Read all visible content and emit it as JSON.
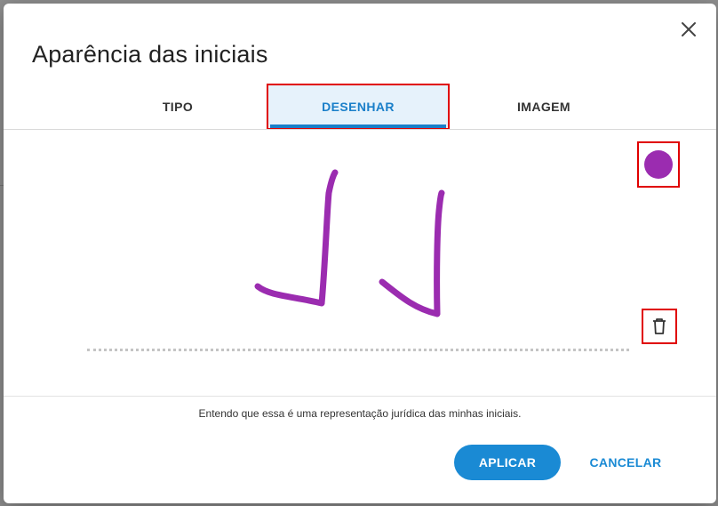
{
  "modal": {
    "title": "Aparência das iniciais",
    "close_icon": "close-icon"
  },
  "tabs": [
    {
      "label": "TIPO",
      "active": false
    },
    {
      "label": "DESENHAR",
      "active": true
    },
    {
      "label": "IMAGEM",
      "active": false
    }
  ],
  "draw": {
    "ink_color": "#9b2cb0",
    "color_picker_icon": "color-circle-icon",
    "delete_icon": "trash-icon"
  },
  "legal_text": "Entendo que essa é uma representação jurídica das minhas iniciais.",
  "buttons": {
    "apply": "APLICAR",
    "cancel": "CANCELAR"
  },
  "colors": {
    "accent": "#1a8ad4",
    "highlight": "#e00000"
  }
}
